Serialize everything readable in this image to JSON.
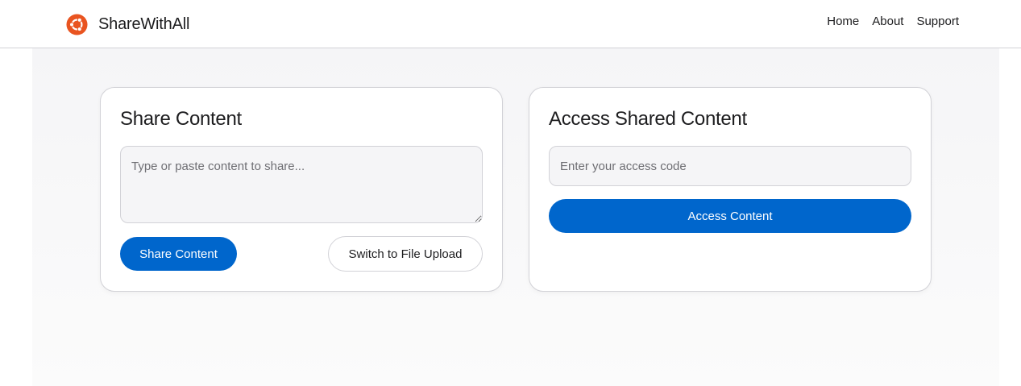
{
  "navbar": {
    "brand_name": "ShareWithAll",
    "logo_icon": "ubuntu-circle-of-friends-icon",
    "logo_color": "#e95420",
    "links": [
      "Home",
      "About",
      "Support"
    ]
  },
  "share_card": {
    "title": "Share Content",
    "textarea_placeholder": "Type or paste content to share...",
    "textarea_value": "",
    "share_button_label": "Share Content",
    "switch_button_label": "Switch to File Upload"
  },
  "access_card": {
    "title": "Access Shared Content",
    "code_placeholder": "Enter your access code",
    "code_value": "",
    "access_button_label": "Access Content"
  },
  "colors": {
    "accent": "#0066cc",
    "page_background": "#f5f5f7",
    "border": "#d2d2d7"
  }
}
